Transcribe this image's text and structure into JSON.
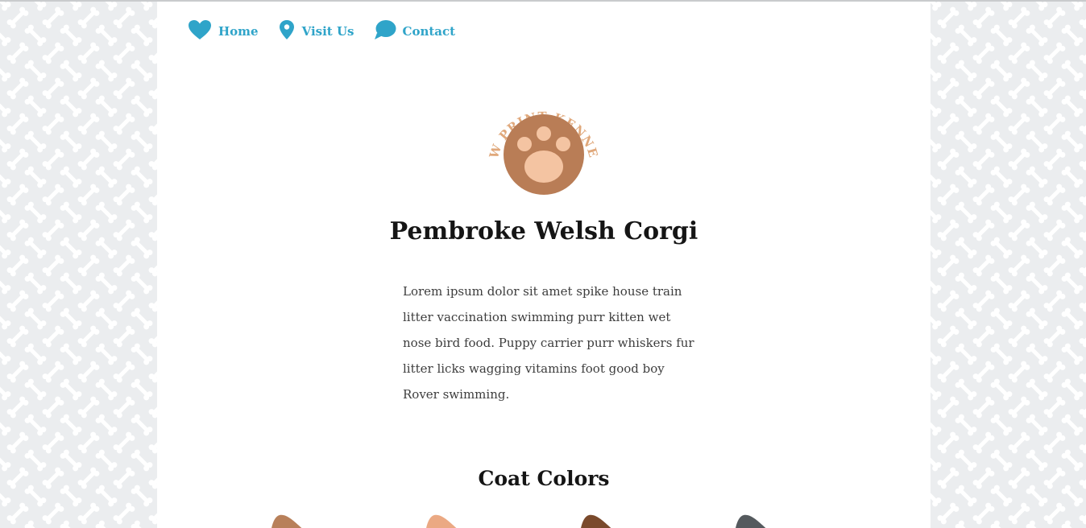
{
  "nav": {
    "items": [
      {
        "label": "Home",
        "icon": "heart-icon"
      },
      {
        "label": "Visit Us",
        "icon": "map-pin-icon"
      },
      {
        "label": "Contact",
        "icon": "speech-bubble-icon"
      }
    ]
  },
  "logo": {
    "text": "PAW PRINT KENNELS",
    "icon": "paw-icon"
  },
  "page": {
    "title": "Pembroke Welsh Corgi",
    "intro": "Lorem ipsum dolor sit amet spike house train litter vaccination swimming purr kitten wet nose bird food. Puppy carrier purr whiskers fur litter licks wagging vitamins foot good boy Rover swimming."
  },
  "coat_colors": {
    "title": "Coat Colors",
    "swatches": [
      {
        "color": "#b8805a"
      },
      {
        "color": "#eba983"
      },
      {
        "color": "#7a4a2c"
      },
      {
        "color": "#555a5e"
      }
    ]
  },
  "colors": {
    "accent": "#2fa4c9",
    "logo_brown": "#b97d56",
    "logo_peach": "#f4c4a2",
    "logo_text": "#e0a87b",
    "background": "#ebedef"
  }
}
